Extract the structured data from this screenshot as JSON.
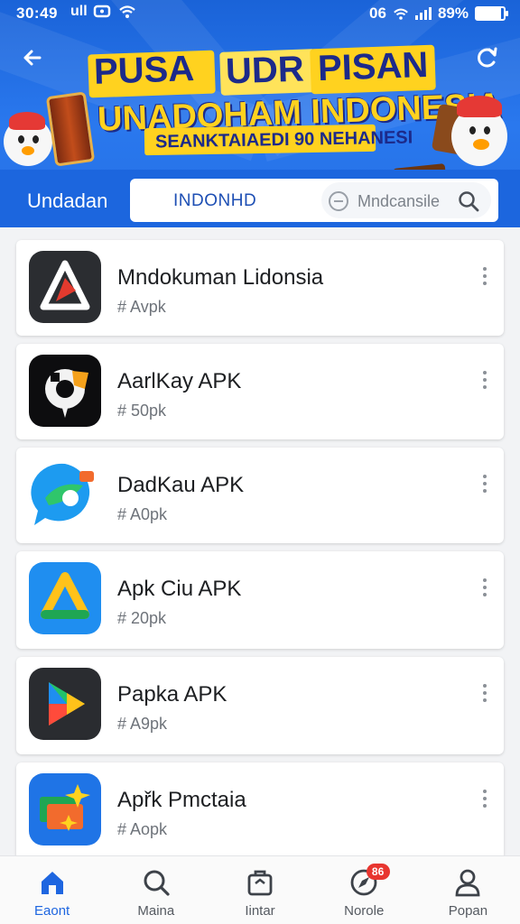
{
  "status_bar": {
    "time": "30:49",
    "carrier_marks": "ull",
    "network": "06",
    "battery": "89%",
    "battery_level": 0.89
  },
  "banner": {
    "line1_a": "PUSA",
    "line1_b": "UDR",
    "line1_c": "PISAN",
    "line2": "UNADOHAM INDONESIA",
    "line3": "SEANKTAIAEDI 90 NEHANESI"
  },
  "search": {
    "label": "Undadan",
    "query": "INDONHD",
    "placeholder": "Mndcansile"
  },
  "apps": [
    {
      "name": "Mndokuman Lidonsia",
      "meta": "# Avpk",
      "icon": "triangle-logo-icon"
    },
    {
      "name": "AarlKay APK",
      "meta": "# 50pk",
      "icon": "gear-robot-icon"
    },
    {
      "name": "DadKau APK",
      "meta": "# A0pk",
      "icon": "chat-bubble-icon"
    },
    {
      "name": "Apk Ciu APK",
      "meta": "# 20pk",
      "icon": "drive-triangle-icon"
    },
    {
      "name": "Papka APK",
      "meta": "# A9pk",
      "icon": "play-store-icon"
    },
    {
      "name": "Apřk Pmctaia",
      "meta": "# Aopk",
      "icon": "sparkle-folder-icon"
    }
  ],
  "nav": [
    {
      "label": "Eaont",
      "icon": "home-icon",
      "active": true
    },
    {
      "label": "Maina",
      "icon": "search-icon",
      "active": false
    },
    {
      "label": "Iintar",
      "icon": "bag-icon",
      "active": false
    },
    {
      "label": "Norole",
      "icon": "compass-icon",
      "active": false,
      "badge": "86"
    },
    {
      "label": "Popan",
      "icon": "person-icon",
      "active": false
    }
  ],
  "colors": {
    "header_blue": "#2470e4",
    "accent_yellow": "#ffd21f",
    "active_nav": "#1e66e0",
    "badge_red": "#e8352f"
  }
}
